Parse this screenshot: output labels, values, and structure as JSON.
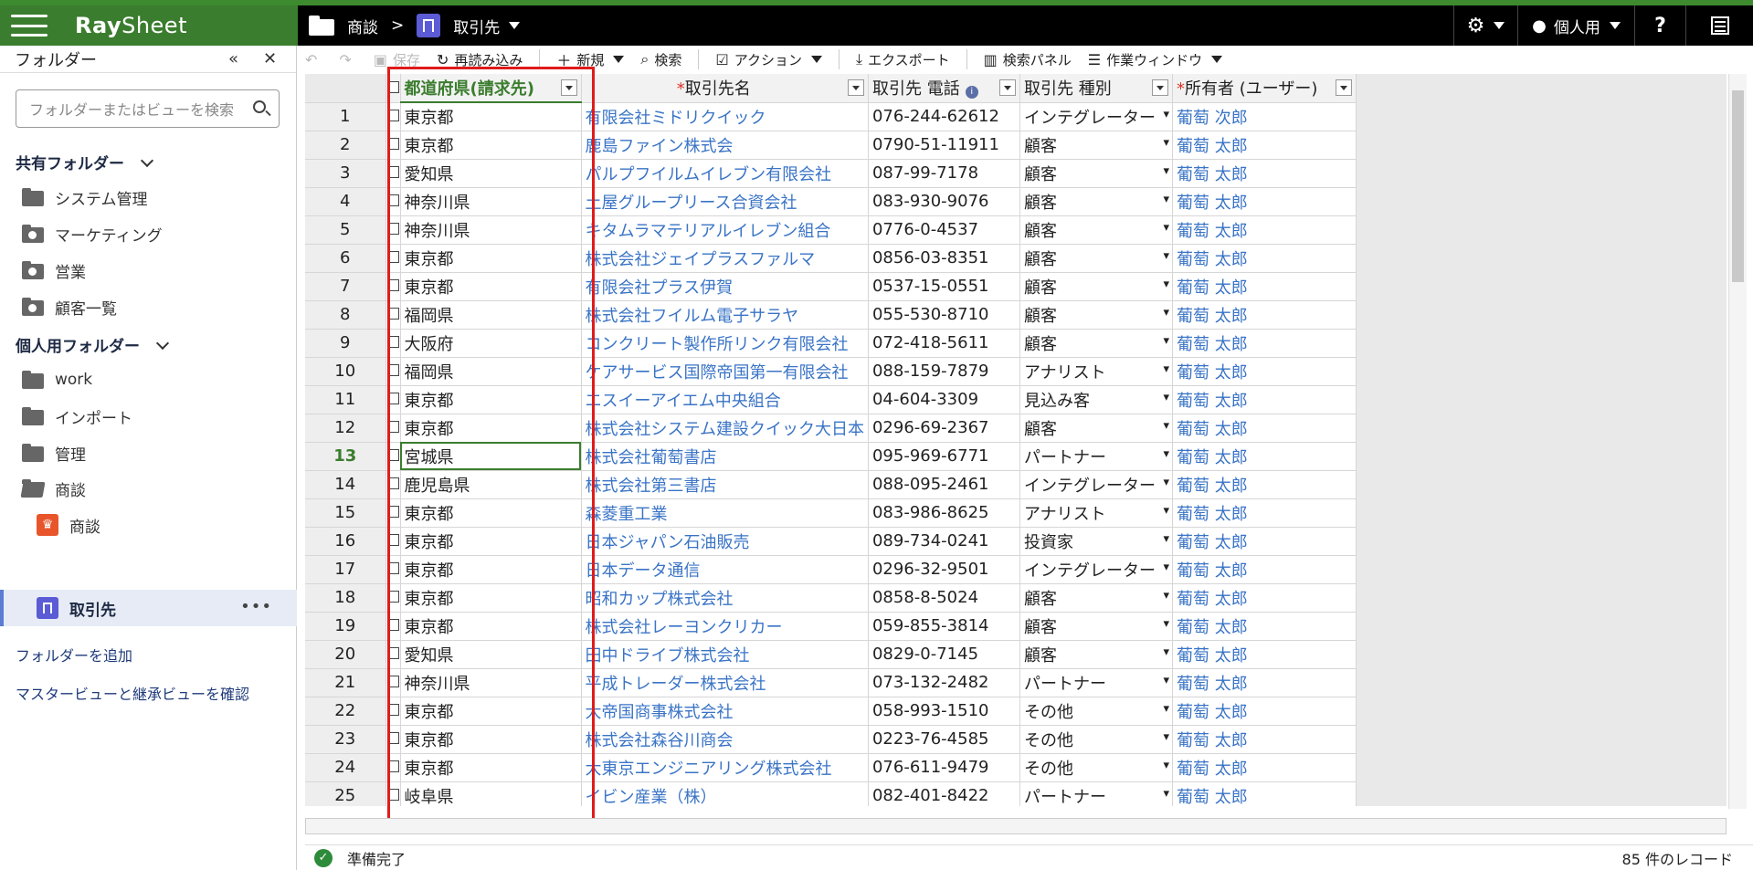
{
  "app": {
    "brand_ray": "Ray",
    "brand_sheet": "Sheet"
  },
  "breadcrumb": {
    "folder": "商談",
    "sep": ">",
    "view": "取引先"
  },
  "topright": {
    "user_label": "個人用",
    "help": "?"
  },
  "sidebar": {
    "title": "フォルダー",
    "collapse": "«",
    "close": "✕",
    "search_placeholder": "フォルダーまたはビューを検索",
    "shared_title": "共有フォルダー",
    "shared": [
      "システム管理",
      "マーケティング",
      "営業",
      "顧客一覧"
    ],
    "personal_title": "個人用フォルダー",
    "personal": [
      "work",
      "インポート",
      "管理",
      "商談"
    ],
    "sub": [
      "商談",
      "取引先"
    ],
    "more": "•••",
    "add_folder": "フォルダーを追加",
    "master_view": "マスタービューと継承ビューを確認"
  },
  "toolbar": {
    "save": "保存",
    "reload": "再読み込み",
    "new": "新規",
    "search": "検索",
    "action": "アクション",
    "export": "エクスポート",
    "search_panel": "検索パネル",
    "work_window": "作業ウィンドウ"
  },
  "columns": {
    "pref": "都道府県(請求先)",
    "name_req": "*",
    "name": "取引先名",
    "phone": "取引先 電話",
    "type": "取引先 種別",
    "owner_req": "*",
    "owner": "所有者 (ユーザー)"
  },
  "rows": [
    {
      "n": "1",
      "pref": "東京都",
      "name": "有限会社ミドリクイック",
      "phone": "076-244-62612",
      "type": "インテグレーター",
      "owner": "葡萄 次郎"
    },
    {
      "n": "2",
      "pref": "東京都",
      "name": "鹿島ファイン株式会",
      "phone": "0790-51-11911",
      "type": "顧客",
      "owner": "葡萄 太郎"
    },
    {
      "n": "3",
      "pref": "愛知県",
      "name": "パルプフイルムイレブン有限会社",
      "phone": "087-99-7178",
      "type": "顧客",
      "owner": "葡萄 太郎"
    },
    {
      "n": "4",
      "pref": "神奈川県",
      "name": "土屋グループリース合資会社",
      "phone": "083-930-9076",
      "type": "顧客",
      "owner": "葡萄 太郎"
    },
    {
      "n": "5",
      "pref": "神奈川県",
      "name": "キタムラマテリアルイレブン組合",
      "phone": "0776-0-4537",
      "type": "顧客",
      "owner": "葡萄 太郎"
    },
    {
      "n": "6",
      "pref": "東京都",
      "name": "株式会社ジェイプラスファルマ",
      "phone": "0856-03-8351",
      "type": "顧客",
      "owner": "葡萄 太郎"
    },
    {
      "n": "7",
      "pref": "東京都",
      "name": "有限会社プラス伊賀",
      "phone": "0537-15-0551",
      "type": "顧客",
      "owner": "葡萄 太郎"
    },
    {
      "n": "8",
      "pref": "福岡県",
      "name": "株式会社フイルム電子サラヤ",
      "phone": "055-530-8710",
      "type": "顧客",
      "owner": "葡萄 太郎"
    },
    {
      "n": "9",
      "pref": "大阪府",
      "name": "コンクリート製作所リンク有限会社",
      "phone": "072-418-5611",
      "type": "顧客",
      "owner": "葡萄 太郎"
    },
    {
      "n": "10",
      "pref": "福岡県",
      "name": "ケアサービス国際帝国第一有限会社",
      "phone": "088-159-7879",
      "type": "アナリスト",
      "owner": "葡萄 太郎"
    },
    {
      "n": "11",
      "pref": "東京都",
      "name": "エスイーアイエム中央組合",
      "phone": "04-604-3309",
      "type": "見込み客",
      "owner": "葡萄 太郎"
    },
    {
      "n": "12",
      "pref": "東京都",
      "name": "株式会社システム建設クイック大日本",
      "phone": "0296-69-2367",
      "type": "顧客",
      "owner": "葡萄 太郎"
    },
    {
      "n": "13",
      "pref": "宮城県",
      "name": "株式会社葡萄書店",
      "phone": "095-969-6771",
      "type": "パートナー",
      "owner": "葡萄 太郎"
    },
    {
      "n": "14",
      "pref": "鹿児島県",
      "name": "株式会社第三書店",
      "phone": "088-095-2461",
      "type": "インテグレーター",
      "owner": "葡萄 太郎"
    },
    {
      "n": "15",
      "pref": "東京都",
      "name": "森菱重工業",
      "phone": "083-986-8625",
      "type": "アナリスト",
      "owner": "葡萄 太郎"
    },
    {
      "n": "16",
      "pref": "東京都",
      "name": "日本ジャパン石油販売",
      "phone": "089-734-0241",
      "type": "投資家",
      "owner": "葡萄 太郎"
    },
    {
      "n": "17",
      "pref": "東京都",
      "name": "日本データ通信",
      "phone": "0296-32-9501",
      "type": "インテグレーター",
      "owner": "葡萄 太郎"
    },
    {
      "n": "18",
      "pref": "東京都",
      "name": "昭和カップ株式会社",
      "phone": "0858-8-5024",
      "type": "顧客",
      "owner": "葡萄 太郎"
    },
    {
      "n": "19",
      "pref": "東京都",
      "name": "株式会社レーヨンクリカー",
      "phone": "059-855-3814",
      "type": "顧客",
      "owner": "葡萄 太郎"
    },
    {
      "n": "20",
      "pref": "愛知県",
      "name": "田中ドライブ株式会社",
      "phone": "0829-0-7145",
      "type": "顧客",
      "owner": "葡萄 太郎"
    },
    {
      "n": "21",
      "pref": "神奈川県",
      "name": "平成トレーダー株式会社",
      "phone": "073-132-2482",
      "type": "パートナー",
      "owner": "葡萄 太郎"
    },
    {
      "n": "22",
      "pref": "東京都",
      "name": "大帝国商事株式会社",
      "phone": "058-993-1510",
      "type": "その他",
      "owner": "葡萄 太郎"
    },
    {
      "n": "23",
      "pref": "東京都",
      "name": "株式会社森谷川商会",
      "phone": "0223-76-4585",
      "type": "その他",
      "owner": "葡萄 太郎"
    },
    {
      "n": "24",
      "pref": "東京都",
      "name": "大東京エンジニアリング株式会社",
      "phone": "076-611-9479",
      "type": "その他",
      "owner": "葡萄 太郎"
    },
    {
      "n": "25",
      "pref": "岐阜県",
      "name": "イビン産業（株）",
      "phone": "082-401-8422",
      "type": "パートナー",
      "owner": "葡萄 太郎"
    }
  ],
  "current_row": "13",
  "status": {
    "text": "準備完了",
    "records": "85 件のレコード"
  }
}
